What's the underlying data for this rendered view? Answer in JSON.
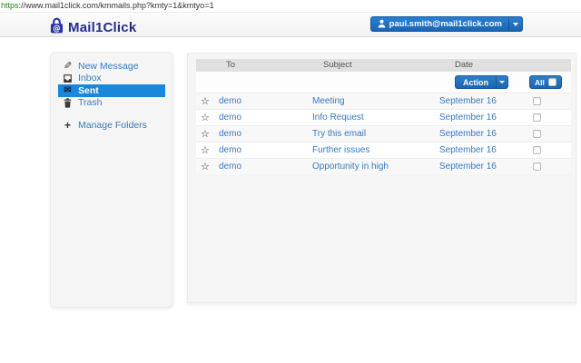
{
  "browser": {
    "url_protocol": "https",
    "url_rest": "://www.mail1click.com/kmmails.php?kmty=1&kmtyo=1"
  },
  "header": {
    "app_name": "Mail1Click",
    "account_email": "paul.smith@mail1click.com"
  },
  "sidebar": {
    "items": [
      {
        "label": "New Message",
        "icon": "pencil-icon",
        "active": false
      },
      {
        "label": "Inbox",
        "icon": "inbox-icon",
        "active": false
      },
      {
        "label": "Sent",
        "icon": "envelope-icon",
        "active": true
      },
      {
        "label": "Trash",
        "icon": "trash-icon",
        "active": false
      },
      {
        "label": "Manage Folders",
        "icon": "plus-icon",
        "active": false
      }
    ]
  },
  "mail_list": {
    "columns": {
      "to": "To",
      "subject": "Subject",
      "date": "Date"
    },
    "action_button_label": "Action",
    "select_all_label": "All",
    "rows": [
      {
        "to": "demo",
        "subject": "Meeting",
        "date": "September 16",
        "starred": false,
        "checked": false
      },
      {
        "to": "demo",
        "subject": "Info Request",
        "date": "September 16",
        "starred": false,
        "checked": false
      },
      {
        "to": "demo",
        "subject": "Try this email",
        "date": "September 16",
        "starred": false,
        "checked": false
      },
      {
        "to": "demo",
        "subject": "Further issues",
        "date": "September 16",
        "starred": false,
        "checked": false
      },
      {
        "to": "demo",
        "subject": "Opportunity in high",
        "date": "September 16",
        "starred": false,
        "checked": false
      }
    ]
  },
  "colors": {
    "accent_button_blue": "#1d70c4",
    "active_item_blue": "#1b87da",
    "link_blue": "#3579bd",
    "logo_navy": "#252d86",
    "table_header_gray": "#e0e0e0",
    "panel_gray": "#f5f5f5",
    "url_https_green": "#1a8a1a"
  },
  "icons": {
    "star": "☆",
    "pencil": "✎",
    "envelope": "✉",
    "plus": "+"
  }
}
